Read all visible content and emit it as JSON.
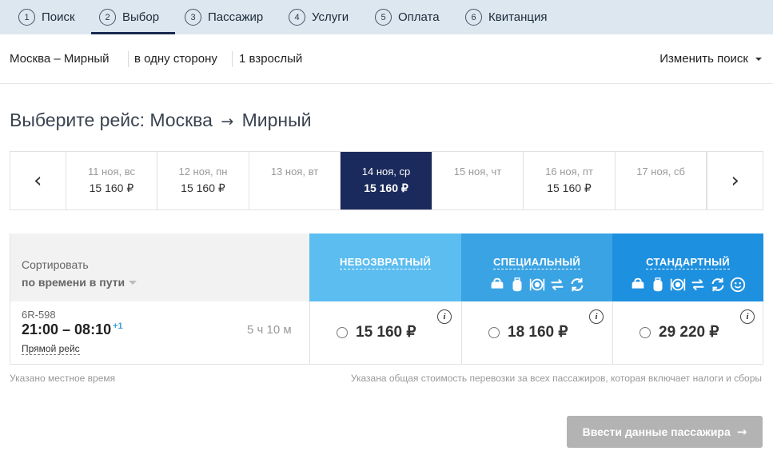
{
  "steps": [
    {
      "num": "1",
      "label": "Поиск"
    },
    {
      "num": "2",
      "label": "Выбор"
    },
    {
      "num": "3",
      "label": "Пассажир"
    },
    {
      "num": "4",
      "label": "Услуги"
    },
    {
      "num": "5",
      "label": "Оплата"
    },
    {
      "num": "6",
      "label": "Квитанция"
    }
  ],
  "active_step": "2",
  "summary": {
    "route": "Москва – Мирный",
    "trip_type": "в одну сторону",
    "passengers": "1 взрослый",
    "change_search": "Изменить поиск"
  },
  "title": {
    "prefix": "Выберите рейс: Москва",
    "arrow": "→",
    "destination": "Мирный"
  },
  "dates": [
    {
      "date": "11 ноя, вс",
      "price": "15 160 ₽"
    },
    {
      "date": "12 ноя, пн",
      "price": "15 160 ₽"
    },
    {
      "date": "13 ноя, вт",
      "price": ""
    },
    {
      "date": "14 ноя, ср",
      "price": "15 160 ₽",
      "selected": true
    },
    {
      "date": "15 ноя, чт",
      "price": ""
    },
    {
      "date": "16 ноя, пт",
      "price": "15 160 ₽"
    },
    {
      "date": "17 ноя, сб",
      "price": ""
    }
  ],
  "sort": {
    "label": "Сортировать",
    "value": "по времени в пути"
  },
  "fares": [
    {
      "name": "НЕВОЗВРАТНЫЙ",
      "color": "#5bbdf0",
      "icons": []
    },
    {
      "name": "СПЕЦИАЛЬНЫЙ",
      "color": "#3aa3e3",
      "icons": [
        "bag-icon",
        "suitcase-icon",
        "meal-icon",
        "exchange-icon",
        "refund-icon"
      ]
    },
    {
      "name": "СТАНДАРТНЫЙ",
      "color": "#1e90e0",
      "icons": [
        "bag-icon",
        "suitcase-icon",
        "meal-icon",
        "exchange-icon",
        "refund-icon",
        "smile-icon"
      ]
    }
  ],
  "flight": {
    "number": "6R-598",
    "time": "21:00 – 08:10",
    "day_offset": "+1",
    "direct": "Прямой рейс",
    "duration": "5 ч 10 м",
    "prices": [
      "15 160 ₽",
      "18 160 ₽",
      "29 220 ₽"
    ],
    "info_icon": "i"
  },
  "notes": {
    "local_time": "Указано местное время",
    "total_cost": "Указана общая стоимость перевозки за всех пассажиров, которая включает налоги и сборы"
  },
  "next_button": {
    "label": "Ввести данные пассажира",
    "arrow": "→"
  }
}
